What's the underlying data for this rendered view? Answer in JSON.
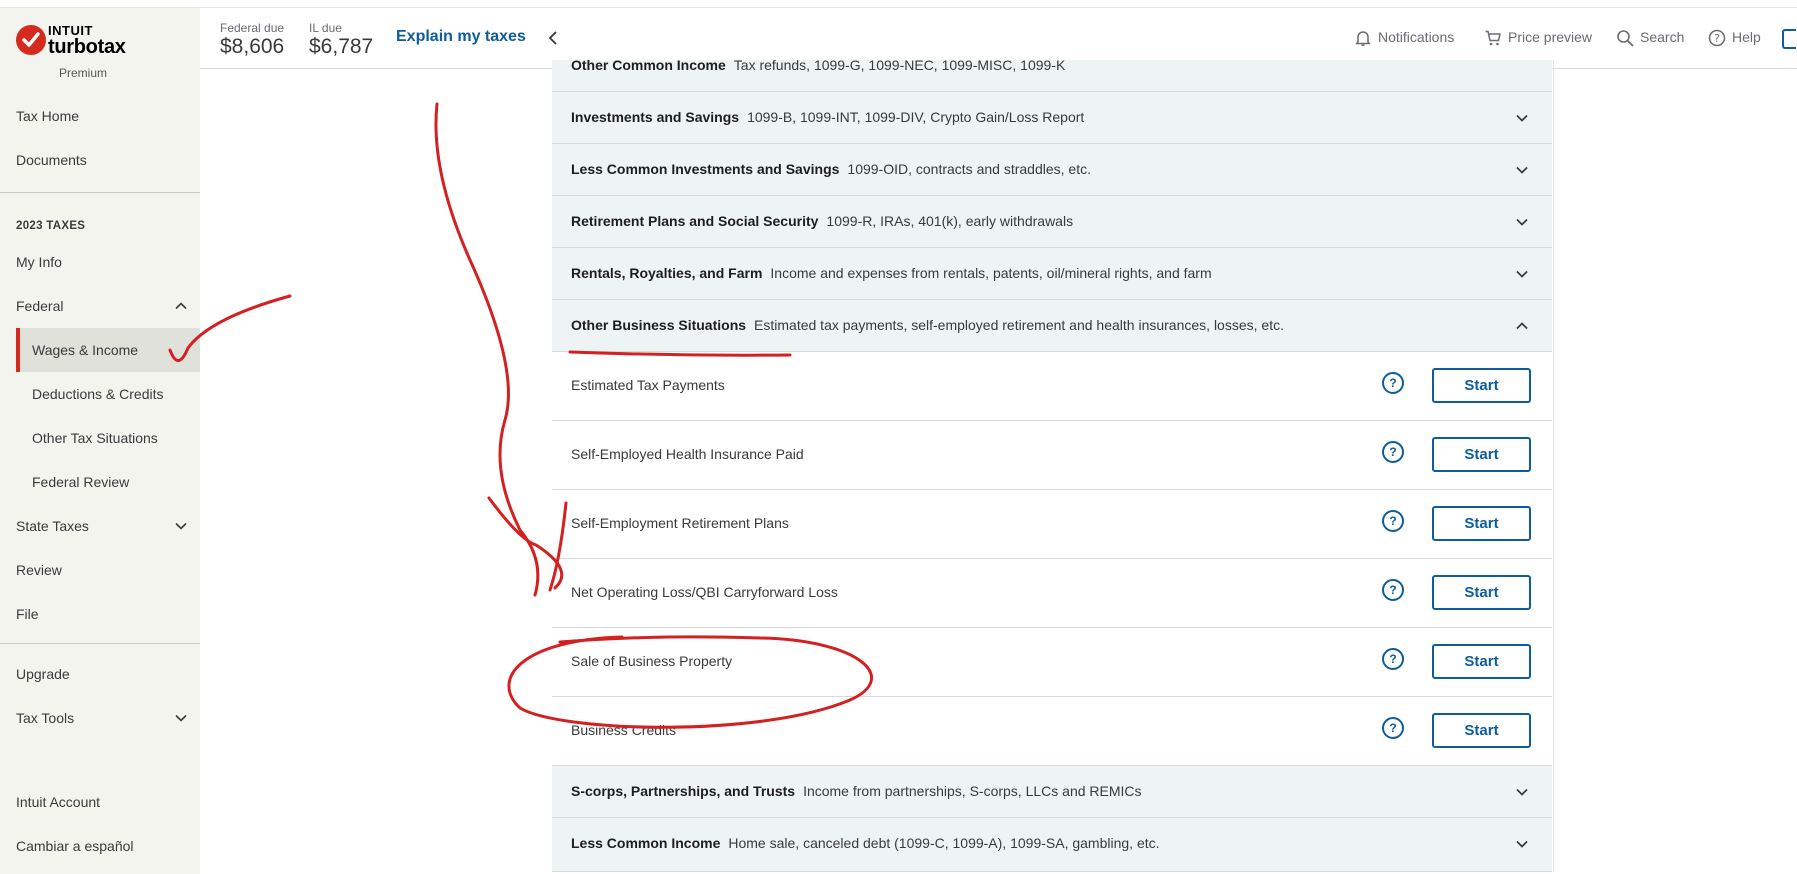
{
  "brand": {
    "company": "INTUIT",
    "product": "turbotax",
    "tier": "Premium",
    "accent_color": "#d52b1e",
    "link_color": "#0d5d9d"
  },
  "sidebar": {
    "top_items": [
      "Tax Home",
      "Documents"
    ],
    "section_title": "2023 TAXES",
    "my_info": "My Info",
    "federal": "Federal",
    "federal_items": [
      "Wages & Income",
      "Deductions & Credits",
      "Other Tax Situations",
      "Federal Review"
    ],
    "active_item": "Wages & Income",
    "state_taxes": "State Taxes",
    "review": "Review",
    "file": "File",
    "upgrade": "Upgrade",
    "tax_tools": "Tax Tools",
    "intuit_account": "Intuit Account",
    "spanish": "Cambiar a español"
  },
  "header": {
    "federal_due_label": "Federal due",
    "federal_due_amount": "$8,606",
    "il_due_label": "IL due",
    "il_due_amount": "$6,787",
    "explain": "Explain my taxes",
    "notifications": "Notifications",
    "price_preview": "Price preview",
    "search": "Search",
    "help": "Help"
  },
  "categories": [
    {
      "title": "Other Common Income",
      "desc": "Tax refunds, 1099-G, 1099-NEC, 1099-MISC, 1099-K"
    },
    {
      "title": "Investments and Savings",
      "desc": "1099-B, 1099-INT, 1099-DIV, Crypto Gain/Loss Report"
    },
    {
      "title": "Less Common Investments and Savings",
      "desc": "1099-OID, contracts and straddles, etc."
    },
    {
      "title": "Retirement Plans and Social Security",
      "desc": "1099-R, IRAs, 401(k), early withdrawals"
    },
    {
      "title": "Rentals, Royalties, and Farm",
      "desc": "Income and expenses from rentals, patents, oil/mineral rights, and farm"
    },
    {
      "title": "Other Business Situations",
      "desc": "Estimated tax payments, self-employed retirement and health insurances, losses, etc.",
      "expanded": true
    },
    {
      "title": "S-corps, Partnerships, and Trusts",
      "desc": "Income from partnerships, S-corps, LLCs and REMICs"
    },
    {
      "title": "Less Common Income",
      "desc": "Home sale, canceled debt (1099-C, 1099-A), 1099-SA, gambling, etc."
    }
  ],
  "subitems": [
    {
      "title": "Estimated Tax Payments",
      "action": "Start"
    },
    {
      "title": "Self-Employed Health Insurance Paid",
      "action": "Start"
    },
    {
      "title": "Self-Employment Retirement Plans",
      "action": "Start"
    },
    {
      "title": "Net Operating Loss/QBI Carryforward Loss",
      "action": "Start"
    },
    {
      "title": "Sale of Business Property",
      "action": "Start"
    },
    {
      "title": "Business Credits",
      "action": "Start"
    }
  ],
  "help_glyph": "?",
  "annotation_color": "#d42020"
}
